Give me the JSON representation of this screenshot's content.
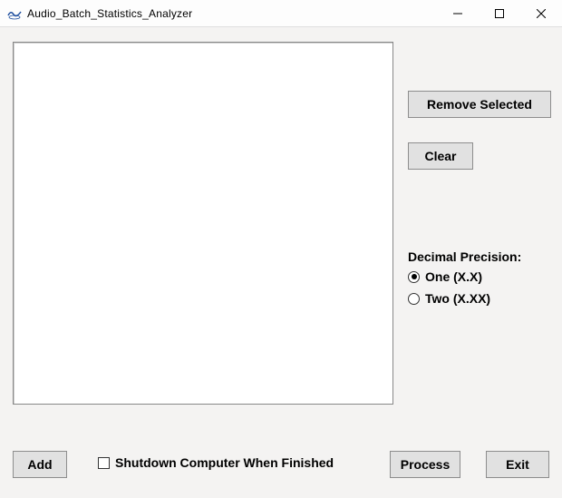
{
  "window": {
    "title": "Audio_Batch_Statistics_Analyzer"
  },
  "buttons": {
    "remove_selected": "Remove Selected",
    "clear": "Clear",
    "add": "Add",
    "process": "Process",
    "exit": "Exit"
  },
  "precision": {
    "label": "Decimal Precision:",
    "options": [
      {
        "id": "one",
        "label": "One (X.X)",
        "checked": true
      },
      {
        "id": "two",
        "label": "Two (X.XX)",
        "checked": false
      }
    ]
  },
  "shutdown": {
    "label": "Shutdown Computer When Finished",
    "checked": false
  },
  "listbox": {
    "items": []
  }
}
